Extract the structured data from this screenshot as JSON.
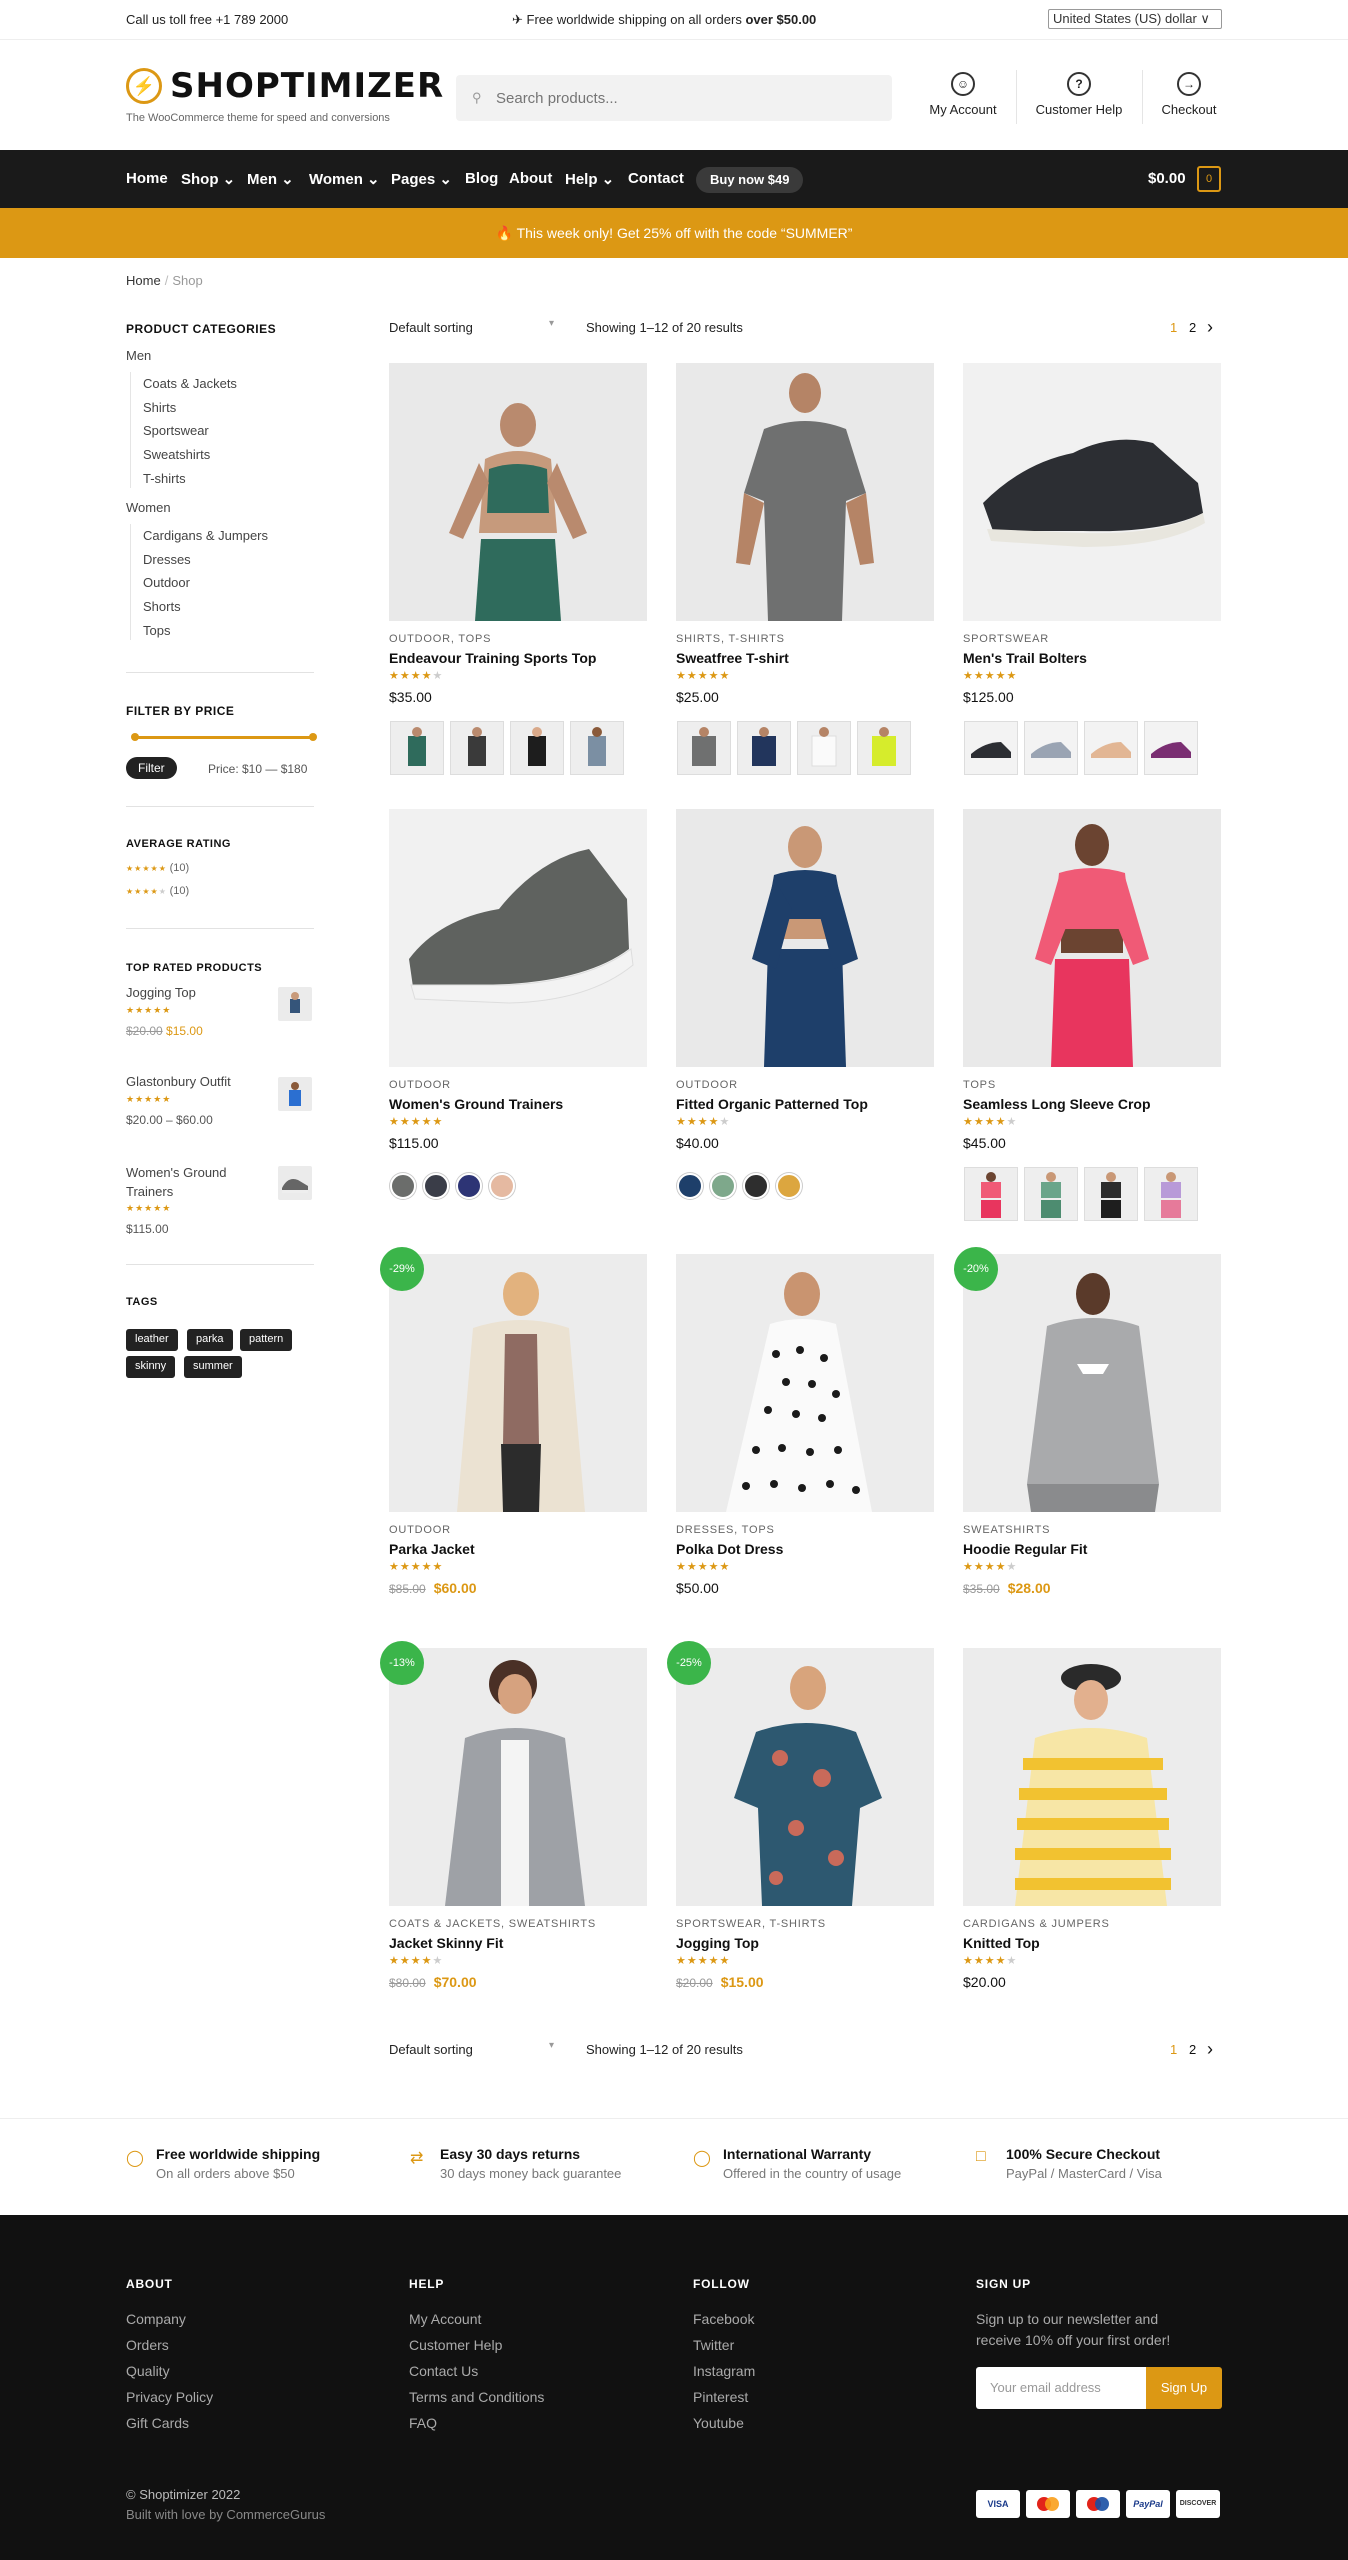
{
  "topbar": {
    "left": "Call us toll free +1 789 2000",
    "center_pre": "✈ Free worldwide shipping on all orders ",
    "center_bold": "over $50.00",
    "currency": "United States (US) dollar ∨"
  },
  "header": {
    "logo_mark": "⚡",
    "logo": "SHOPTIMIZER",
    "tagline": "The WooCommerce theme for speed and conversions",
    "search_placeholder": "Search products...",
    "search_icon": "search-icon",
    "account": "My Account",
    "help": "Customer Help",
    "checkout": "Checkout"
  },
  "nav": {
    "items": [
      {
        "label": "Home"
      },
      {
        "label": "Shop ⌄"
      },
      {
        "label": "Men ⌄"
      },
      {
        "label": "Women ⌄"
      },
      {
        "label": "Pages ⌄"
      },
      {
        "label": "Blog"
      },
      {
        "label": "About"
      },
      {
        "label": "Help ⌄"
      },
      {
        "label": "Contact"
      }
    ],
    "buy": "Buy now $49",
    "cart_total": "$0.00",
    "cart_count": "0"
  },
  "promo": "🔥 This week only! Get 25% off with the code “SUMMER”",
  "breadcrumb": {
    "home": "Home",
    "sep": "/",
    "current": "Shop"
  },
  "sidebar": {
    "cat_title": "PRODUCT CATEGORIES",
    "men": "Men",
    "men_items": [
      "Coats & Jackets",
      "Shirts",
      "Sportswear",
      "Sweatshirts",
      "T-shirts"
    ],
    "women": "Women",
    "women_items": [
      "Cardigans & Jumpers",
      "Dresses",
      "Outdoor",
      "Shorts",
      "Tops"
    ],
    "price_title": "FILTER BY PRICE",
    "filter_btn": "Filter",
    "price_range": "Price: $10 — $180",
    "rating_title": "AVERAGE RATING",
    "ratings": [
      {
        "stars": "★★★★★",
        "count": "(10)"
      },
      {
        "stars": "★★★★",
        "empty": "★",
        "count": "(10)"
      }
    ],
    "top_title": "TOP RATED PRODUCTS",
    "top": [
      {
        "name": "Jogging Top",
        "old": "$20.00",
        "price": "$15.00"
      },
      {
        "name": "Glastonbury Outfit",
        "price": "$20.00 – $60.00"
      },
      {
        "name": "Women's Ground Trainers",
        "price": "$115.00"
      }
    ],
    "tags_title": "TAGS",
    "tags": [
      "leather",
      "parka",
      "pattern",
      "skinny",
      "summer"
    ]
  },
  "toolbar": {
    "sorting": "Default sorting",
    "showing": "Showing 1–12 of 20 results",
    "page1": "1",
    "page2": "2",
    "next": "›"
  },
  "products": [
    {
      "cat": "OUTDOOR, TOPS",
      "name": "Endeavour Training Sports Top",
      "price": "$35.00",
      "rating": 4
    },
    {
      "cat": "SHIRTS, T-SHIRTS",
      "name": "Sweatfree T-shirt",
      "price": "$25.00",
      "rating": 5
    },
    {
      "cat": "SPORTSWEAR",
      "name": "Men's Trail Bolters",
      "price": "$125.00",
      "rating": 5
    },
    {
      "cat": "OUTDOOR",
      "name": "Women's Ground Trainers",
      "price": "$115.00",
      "rating": 5
    },
    {
      "cat": "OUTDOOR",
      "name": "Fitted Organic Patterned Top",
      "price": "$40.00",
      "rating": 4
    },
    {
      "cat": "TOPS",
      "name": "Seamless Long Sleeve Crop",
      "price": "$45.00",
      "rating": 4
    },
    {
      "cat": "OUTDOOR",
      "name": "Parka Jacket",
      "old": "$85.00",
      "price": "$60.00",
      "rating": 5,
      "badge": "-29%"
    },
    {
      "cat": "DRESSES, TOPS",
      "name": "Polka Dot Dress",
      "price": "$50.00",
      "rating": 5
    },
    {
      "cat": "SWEATSHIRTS",
      "name": "Hoodie Regular Fit",
      "old": "$35.00",
      "price": "$28.00",
      "rating": 4,
      "badge": "-20%"
    },
    {
      "cat": "COATS & JACKETS, SWEATSHIRTS",
      "name": "Jacket Skinny Fit",
      "old": "$80.00",
      "price": "$70.00",
      "rating": 4,
      "badge": "-13%"
    },
    {
      "cat": "SPORTSWEAR, T-SHIRTS",
      "name": "Jogging Top",
      "old": "$20.00",
      "price": "$15.00",
      "rating": 5,
      "badge": "-25%"
    },
    {
      "cat": "CARDIGANS & JUMPERS",
      "name": "Knitted Top",
      "price": "$20.00",
      "rating": 4
    }
  ],
  "features": [
    {
      "title": "Free worldwide shipping",
      "sub": "On all orders above $50"
    },
    {
      "title": "Easy 30 days returns",
      "sub": "30 days money back guarantee"
    },
    {
      "title": "International Warranty",
      "sub": "Offered in the country of usage"
    },
    {
      "title": "100% Secure Checkout",
      "sub": "PayPal / MasterCard / Visa"
    }
  ],
  "footer": {
    "about_h": "ABOUT",
    "about": [
      "Company",
      "Orders",
      "Quality",
      "Privacy Policy",
      "Gift Cards"
    ],
    "help_h": "HELP",
    "help": [
      "My Account",
      "Customer Help",
      "Contact Us",
      "Terms and Conditions",
      "FAQ"
    ],
    "follow_h": "FOLLOW",
    "follow": [
      "Facebook",
      "Twitter",
      "Instagram",
      "Pinterest",
      "Youtube"
    ],
    "signup_h": "SIGN UP",
    "signup_text1": "Sign up to our newsletter and",
    "signup_text2": "receive 10% off your first order!",
    "email_placeholder": "Your email address",
    "signup_btn": "Sign Up",
    "copyright": "© Shoptimizer 2022",
    "built": "Built with love by CommerceGurus",
    "cards": [
      "VISA",
      "MC",
      "MC",
      "PayPal",
      "DISCOVER"
    ]
  },
  "colors": {
    "accent": "#dc9814",
    "dark": "#1a1a1a",
    "badge": "#3bb54a"
  }
}
